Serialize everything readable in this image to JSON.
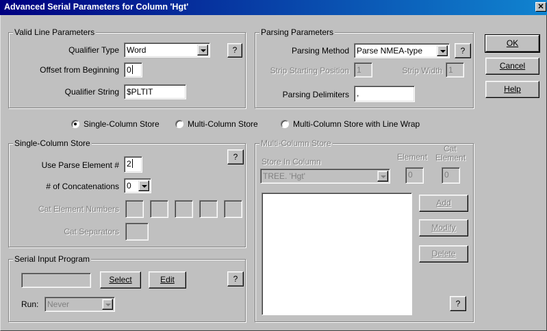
{
  "window": {
    "title": "Advanced Serial Parameters for Column 'Hgt'",
    "close_glyph": "✕"
  },
  "dialog_buttons": {
    "ok": "OK",
    "cancel": "Cancel",
    "help": "Help"
  },
  "valid_line": {
    "legend": "Valid Line Parameters",
    "qualifier_type_label": "Qualifier Type",
    "qualifier_type_value": "Word",
    "offset_label": "Offset from Beginning",
    "offset_value": "0",
    "qualifier_string_label": "Qualifier String",
    "qualifier_string_value": "$PLTIT",
    "help": "?"
  },
  "parsing": {
    "legend": "Parsing Parameters",
    "method_label": "Parsing Method",
    "method_value": "Parse NMEA-type",
    "strip_start_label": "Strip Starting Position",
    "strip_start_value": "1",
    "strip_width_label": "Strip Width",
    "strip_width_value": "1",
    "delimiters_label": "Parsing Delimiters",
    "delimiters_value": ",",
    "help": "?"
  },
  "store_mode": {
    "options": [
      "Single-Column Store",
      "Multi-Column Store",
      "Multi-Column Store with Line Wrap"
    ],
    "selected": "Single-Column Store"
  },
  "single_store": {
    "legend": "Single-Column Store",
    "parse_element_label": "Use Parse Element #",
    "parse_element_value": "2",
    "concat_label": "# of Concatenations",
    "concat_value": "0",
    "cat_numbers_label": "Cat Element Numbers",
    "cat_separators_label": "Cat Separators",
    "help": "?"
  },
  "multi_store": {
    "legend": "Multi-Column Store",
    "store_in_label": "Store In Column",
    "store_in_value": "TREE. 'Hgt'",
    "element_label": "Element",
    "element_value": "0",
    "cat_element_label_1": "Cat",
    "cat_element_label_2": "Element",
    "cat_element_value": "0",
    "add": "Add",
    "modify": "Modify",
    "delete": "Delete",
    "help": "?"
  },
  "serial_program": {
    "legend": "Serial Input Program",
    "select": "Select",
    "edit": "Edit",
    "run_label": "Run:",
    "run_value": "Never",
    "help": "?"
  }
}
